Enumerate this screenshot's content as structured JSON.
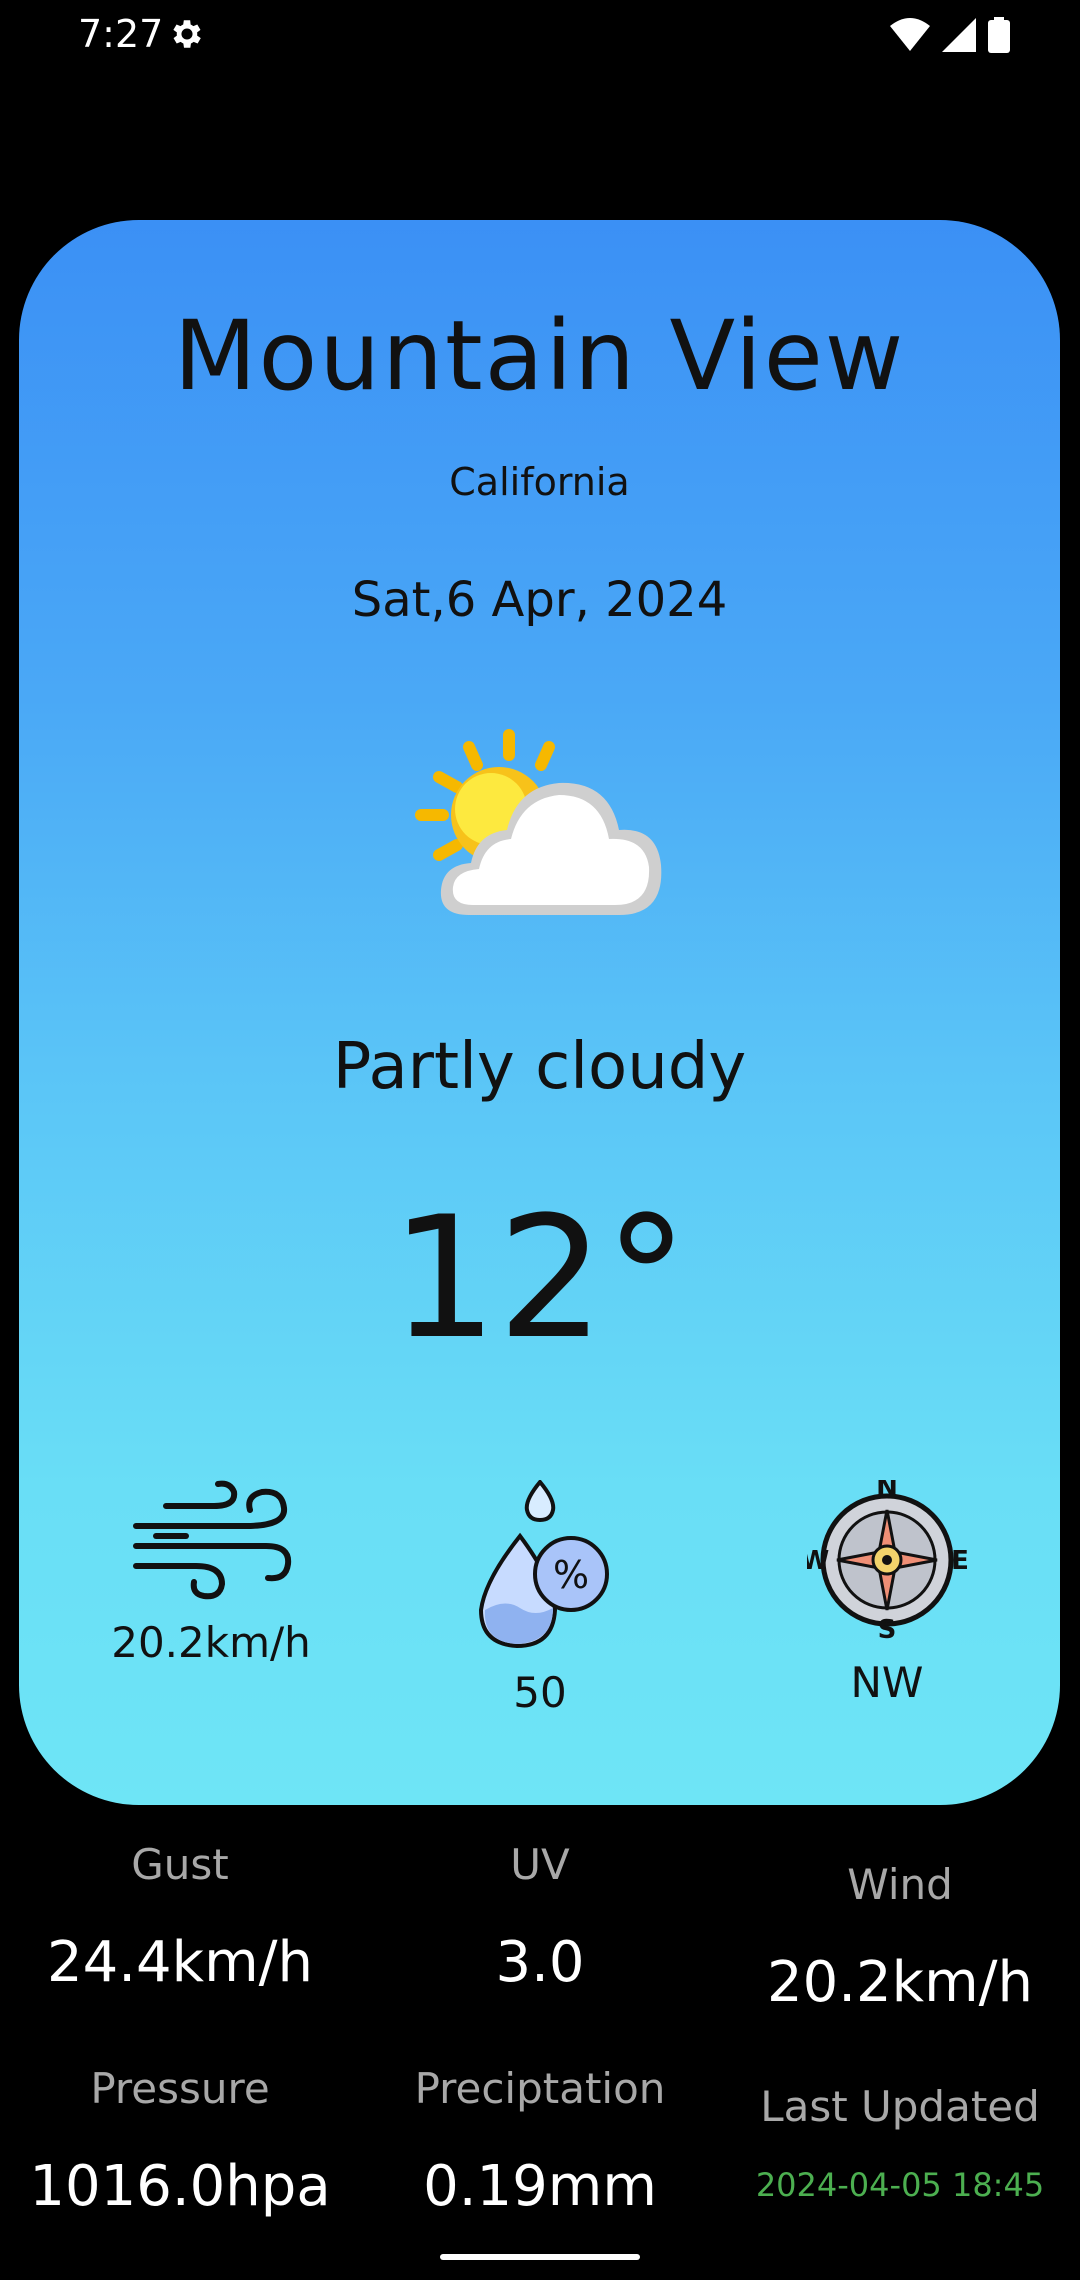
{
  "status_bar": {
    "time": "7:27",
    "icons": [
      "settings-icon",
      "wifi-icon",
      "signal-icon",
      "battery-icon"
    ]
  },
  "location": {
    "city": "Mountain View",
    "region": "California"
  },
  "date": "Sat,6 Apr, 2024",
  "condition": {
    "text": "Partly cloudy",
    "icon": "partly-cloudy-icon"
  },
  "temperature": "12°",
  "stats": {
    "wind_speed": "20.2km/h",
    "humidity": "50",
    "wind_direction": "NW"
  },
  "details": {
    "gust": {
      "label": "Gust",
      "value": "24.4km/h"
    },
    "uv": {
      "label": "UV",
      "value": "3.0"
    },
    "wind": {
      "label": "Wind",
      "value": "20.2km/h"
    },
    "pressure": {
      "label": "Pressure",
      "value": "1016.0hpa"
    },
    "precipitation": {
      "label": "Preciptation",
      "value": "0.19mm"
    },
    "last_updated": {
      "label": "Last Updated",
      "value": "2024-04-05 18:45"
    }
  },
  "colors": {
    "card_top": "#3b90f5",
    "card_bottom": "#6ee5f6",
    "updated_text": "#4caf50"
  }
}
